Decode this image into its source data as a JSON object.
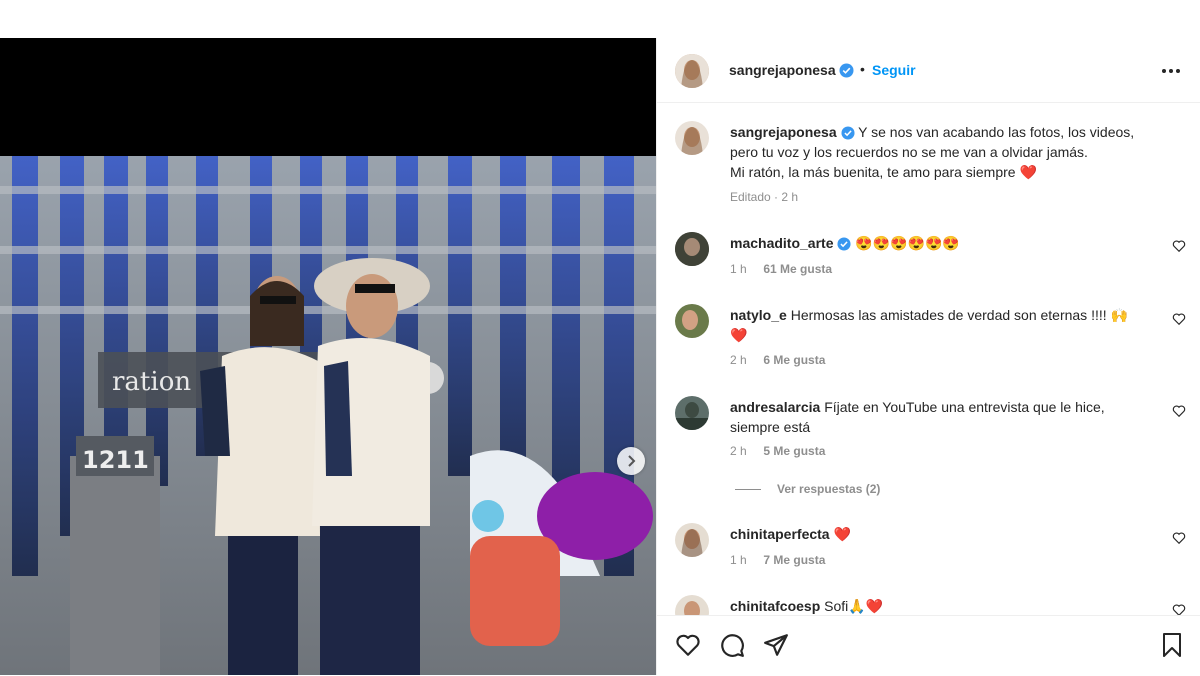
{
  "post": {
    "author": "sangrejaponesa",
    "separator": "•",
    "follow_label": "Seguir",
    "caption": {
      "author": "sangrejaponesa",
      "line1": "Y se nos van acabando las fotos, los videos,",
      "line2": "pero tu voz y los recuerdos no se me van a olvidar jamás.",
      "line3": "Mi ratón, la más buenita, te amo para siempre",
      "heart": "❤️",
      "meta": "Editado · 2 h"
    }
  },
  "comments": [
    {
      "user": "machadito_arte",
      "text": "😍😍😍😍😍😍",
      "time": "1 h",
      "likes": "61 Me gusta",
      "verified": true
    },
    {
      "user": "natylo_e",
      "text": "Hermosas las amistades de verdad son eternas !!!! 🙌",
      "text2": "❤️",
      "time": "2 h",
      "likes": "6 Me gusta"
    },
    {
      "user": "andresalarcia",
      "text": "Fíjate en YouTube una entrevista que le hice,",
      "text2": "siempre está",
      "time": "2 h",
      "likes": "5 Me gusta",
      "replies": "Ver respuestas (2)"
    },
    {
      "user": "chinitaperfecta",
      "text": "❤️",
      "time": "1 h",
      "likes": "7 Me gusta"
    },
    {
      "user": "chinitafcoesp",
      "text": "Sofi🙏❤️"
    }
  ],
  "photo_signs": {
    "sign1": "ration",
    "sign2": "1211"
  },
  "colors": {
    "accent": "#0095f6",
    "verified": "#3897f0",
    "heart": "#ed4956"
  },
  "icons": {
    "like": "heart-icon",
    "comment": "comment-icon",
    "share": "paper-plane-icon",
    "save": "bookmark-icon",
    "more": "more-horizontal-icon",
    "next": "chevron-right-icon"
  }
}
